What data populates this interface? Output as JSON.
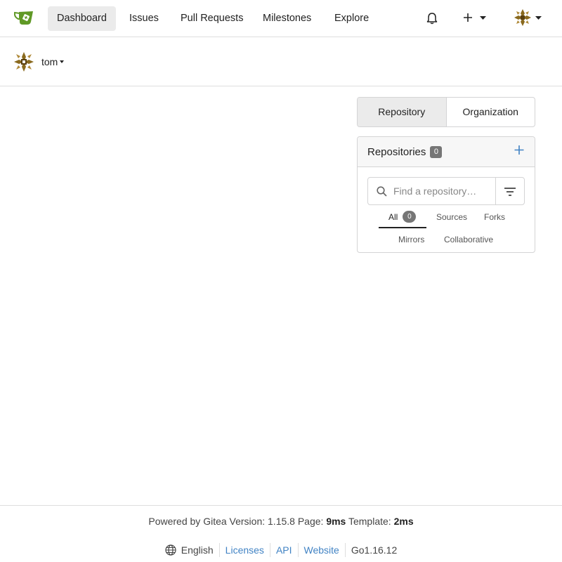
{
  "nav": {
    "items": [
      {
        "label": "Dashboard",
        "active": true
      },
      {
        "label": "Issues"
      },
      {
        "label": "Pull Requests"
      },
      {
        "label": "Milestones"
      },
      {
        "label": "Explore"
      }
    ],
    "icons": [
      "gitea-logo-icon",
      "bell-icon",
      "plus-icon",
      "avatar"
    ]
  },
  "user": {
    "name": "tom"
  },
  "switcher": {
    "repository": "Repository",
    "organization": "Organization"
  },
  "repos": {
    "title": "Repositories",
    "count": "0",
    "search_placeholder": "Find a repository…",
    "tabs": {
      "all": "All",
      "all_count": "0",
      "sources": "Sources",
      "forks": "Forks",
      "mirrors": "Mirrors",
      "collaborative": "Collaborative"
    }
  },
  "footer": {
    "powered_prefix": "Powered by Gitea Version: 1.15.8 Page: ",
    "page_time": "9ms",
    "template_prefix": " Template: ",
    "template_time": "2ms",
    "language": "English",
    "licenses": "Licenses",
    "api": "API",
    "website": "Website",
    "go_version": "Go1.16.12"
  },
  "colors": {
    "accent": "#4183c4",
    "logo_green": "#609926",
    "badge": "#767676"
  }
}
